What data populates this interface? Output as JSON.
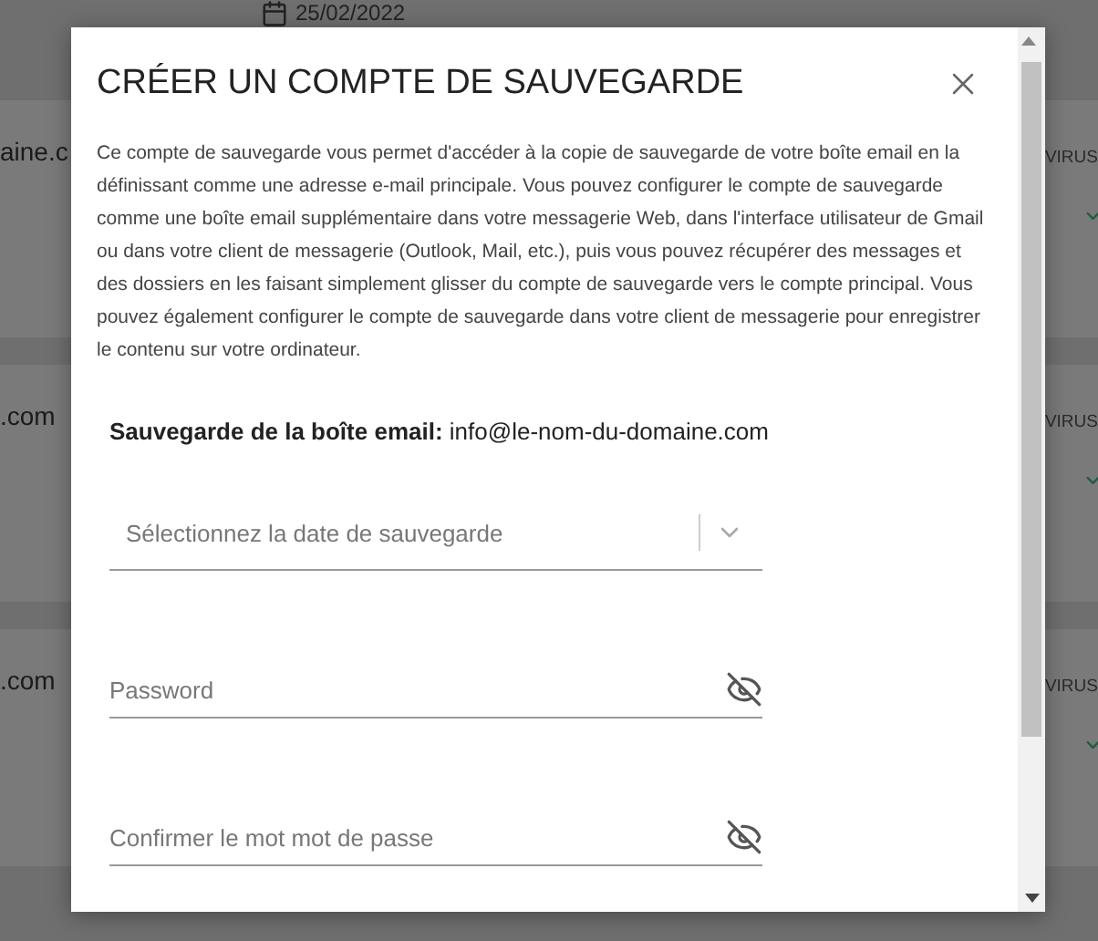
{
  "background": {
    "date": "25/02/2022",
    "rows": [
      {
        "domain": "aine.c",
        "status": "VIRUS"
      },
      {
        "domain": ".com",
        "status": "VIRUS"
      },
      {
        "domain": ".com",
        "status": "VIRUS"
      }
    ]
  },
  "dialog": {
    "title": "CRÉER UN COMPTE DE SAUVEGARDE",
    "description": "Ce compte de sauvegarde vous permet d'accéder à la copie de sauvegarde de votre boîte email en la définissant comme une adresse e-mail principale. Vous pouvez configurer le compte de sauvegarde comme une boîte email supplémentaire dans votre messagerie Web, dans l'interface utilisateur de Gmail ou dans votre client de messagerie (Outlook, Mail, etc.), puis vous pouvez récupérer des messages et des dossiers en les faisant simplement glisser du compte de sauvegarde vers le compte principal. Vous pouvez également configurer le compte de sauvegarde dans votre client de messagerie pour enregistrer le contenu sur votre ordinateur.",
    "mailbox_label": "Sauvegarde de la boîte email:",
    "mailbox_value": "info@le-nom-du-domaine.com",
    "fields": [
      {
        "kind": "select",
        "placeholder": "Sélectionnez la date de sauvegarde"
      },
      {
        "kind": "password",
        "placeholder": "Password"
      },
      {
        "kind": "password",
        "placeholder": "Confirmer le mot mot de passe"
      }
    ]
  }
}
